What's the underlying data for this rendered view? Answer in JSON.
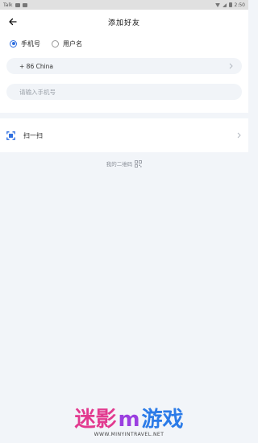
{
  "status_bar": {
    "left_text": "Talk",
    "time": "2:50"
  },
  "header": {
    "title": "添加好友",
    "back_icon": "arrow-left-icon"
  },
  "search_mode": {
    "options": [
      {
        "label": "手机号",
        "checked": true
      },
      {
        "label": "用户名",
        "checked": false
      }
    ],
    "accent_color": "#2f6fe0"
  },
  "country": {
    "value": "+ 86 China"
  },
  "phone": {
    "value": "",
    "placeholder": "请输入手机号"
  },
  "scan": {
    "label": "扫一扫",
    "icon": "scan-icon",
    "icon_color": "#2f6fe0"
  },
  "qr_hint": {
    "label": "我的二维码",
    "icon": "qr-code-icon"
  },
  "watermark": {
    "part1": "迷影",
    "part2": "m",
    "part3": "游戏",
    "url": "WWW.MINYINTRAVEL.NET"
  }
}
